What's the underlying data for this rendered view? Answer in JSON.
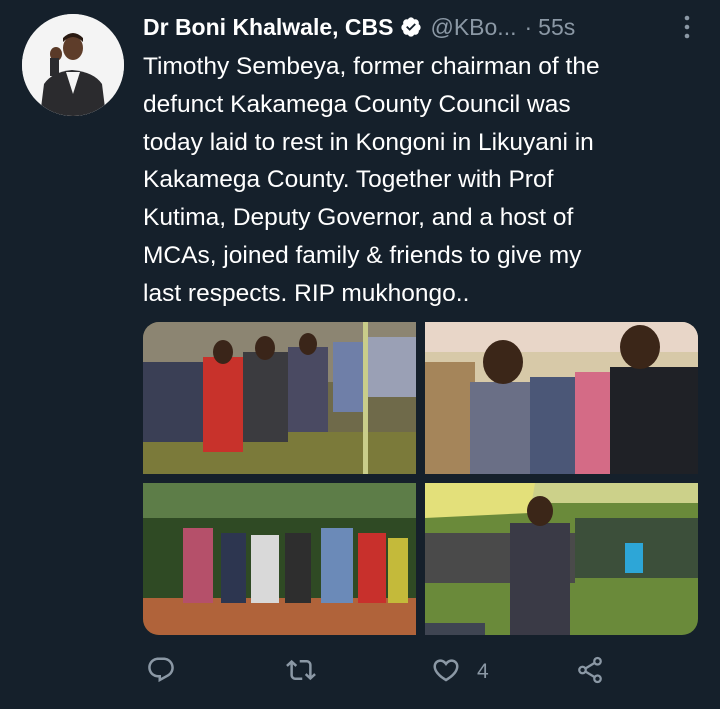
{
  "tweet": {
    "author_name": "Dr Boni Khalwale, CBS",
    "handle": "@KBo...",
    "separator": "·",
    "time": "55s",
    "text_lines": [
      "Timothy Sembeya, former chairman of the",
      "defunct Kakamega County Council was",
      "today laid to rest in Kongoni in Likuyani in",
      "Kakamega County. Together with Prof",
      "Kutima, Deputy Governor, and a host of",
      "MCAs, joined family & friends to give my",
      "last respects. RIP mukhongo.."
    ],
    "actions": {
      "reply_icon": "reply-icon",
      "retweet_icon": "retweet-icon",
      "like_icon": "heart-icon",
      "like_count": "4",
      "share_icon": "share-icon"
    }
  },
  "colors": {
    "background": "#15202b",
    "text": "#ffffff",
    "secondary": "#8b98a5"
  }
}
